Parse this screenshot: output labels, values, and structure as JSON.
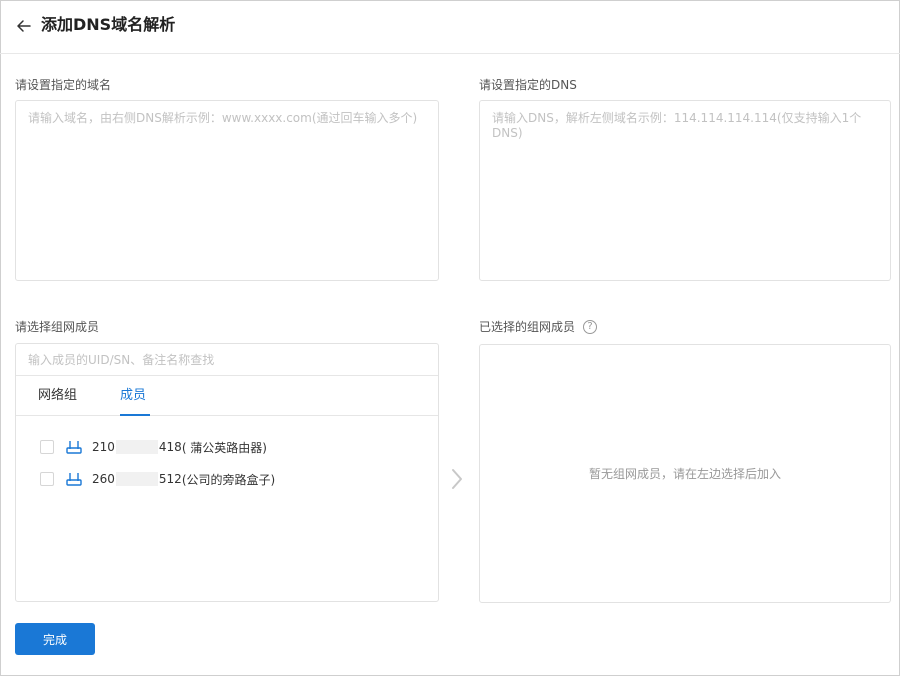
{
  "header": {
    "title": "添加DNS域名解析"
  },
  "domain_section": {
    "label": "请设置指定的域名",
    "placeholder": "请输入域名，由右侧DNS解析示例：www.xxxx.com(通过回车输入多个)"
  },
  "dns_section": {
    "label": "请设置指定的DNS",
    "placeholder": "请输入DNS，解析左侧域名示例：114.114.114.114(仅支持输入1个DNS)"
  },
  "member_select": {
    "label": "请选择组网成员",
    "search_placeholder": "输入成员的UID/SN、备注名称查找",
    "tabs": [
      {
        "label": "网络组"
      },
      {
        "label": "成员"
      }
    ],
    "active_tab": "成员",
    "members": [
      {
        "id_prefix": "210",
        "id_suffix": "418",
        "note": " ( 蒲公英路由器)"
      },
      {
        "id_prefix": "260",
        "id_suffix": "512",
        "note": " (公司的旁路盒子)"
      }
    ]
  },
  "selected_members": {
    "label": "已选择的组网成员",
    "help_icon": "?",
    "empty_text": "暂无组网成员，请在左边选择后加入"
  },
  "footer": {
    "done_label": "完成"
  },
  "colors": {
    "accent": "#1a78d6",
    "border": "#e2e2e2",
    "placeholder": "#c2c2c2"
  }
}
